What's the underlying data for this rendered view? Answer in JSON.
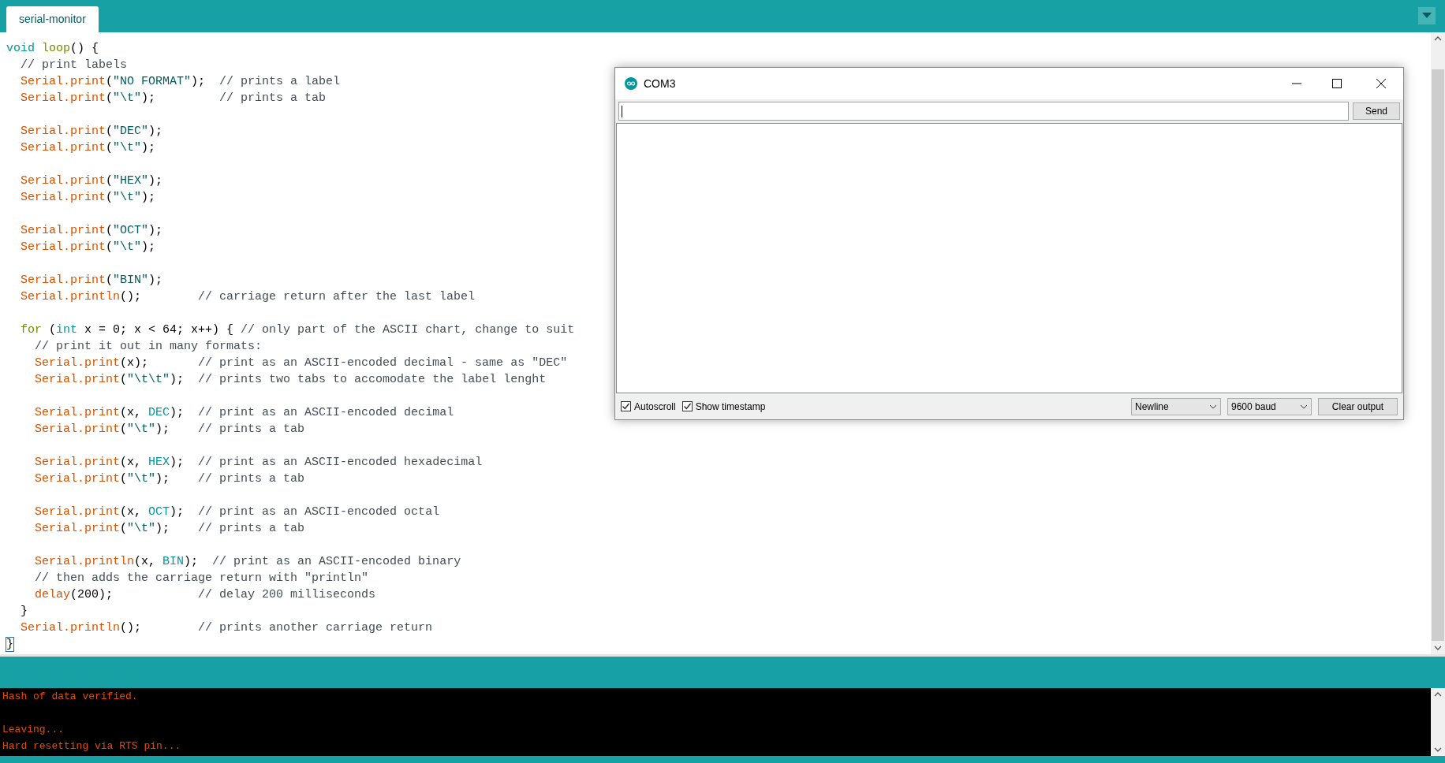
{
  "tabs": [
    {
      "label": "serial-monitor",
      "selected": true
    }
  ],
  "editor": {
    "blocks": [
      [
        [
          {
            "kind": "kw",
            "text": "void "
          },
          {
            "kind": "ctl",
            "text": "loop"
          },
          {
            "kind": "txt",
            "text": "() {"
          }
        ],
        [
          {
            "kind": "com",
            "text": "  // print labels"
          }
        ],
        [
          {
            "kind": "fn",
            "text": "  Serial.print"
          },
          {
            "kind": "txt",
            "text": "("
          },
          {
            "kind": "str",
            "text": "\"NO FORMAT\""
          },
          {
            "kind": "txt",
            "text": ");  "
          },
          {
            "kind": "com",
            "text": "// prints a label"
          }
        ],
        [
          {
            "kind": "fn",
            "text": "  Serial.print"
          },
          {
            "kind": "txt",
            "text": "("
          },
          {
            "kind": "str",
            "text": "\"\\t\""
          },
          {
            "kind": "txt",
            "text": ");         "
          },
          {
            "kind": "com",
            "text": "// prints a tab"
          }
        ]
      ],
      [
        [
          {
            "kind": "fn",
            "text": "  Serial.print"
          },
          {
            "kind": "txt",
            "text": "("
          },
          {
            "kind": "str",
            "text": "\"DEC\""
          },
          {
            "kind": "txt",
            "text": ");"
          }
        ],
        [
          {
            "kind": "fn",
            "text": "  Serial.print"
          },
          {
            "kind": "txt",
            "text": "("
          },
          {
            "kind": "str",
            "text": "\"\\t\""
          },
          {
            "kind": "txt",
            "text": ");"
          }
        ]
      ],
      [
        [
          {
            "kind": "fn",
            "text": "  Serial.print"
          },
          {
            "kind": "txt",
            "text": "("
          },
          {
            "kind": "str",
            "text": "\"HEX\""
          },
          {
            "kind": "txt",
            "text": ");"
          }
        ],
        [
          {
            "kind": "fn",
            "text": "  Serial.print"
          },
          {
            "kind": "txt",
            "text": "("
          },
          {
            "kind": "str",
            "text": "\"\\t\""
          },
          {
            "kind": "txt",
            "text": ");"
          }
        ]
      ],
      [
        [
          {
            "kind": "fn",
            "text": "  Serial.print"
          },
          {
            "kind": "txt",
            "text": "("
          },
          {
            "kind": "str",
            "text": "\"OCT\""
          },
          {
            "kind": "txt",
            "text": ");"
          }
        ],
        [
          {
            "kind": "fn",
            "text": "  Serial.print"
          },
          {
            "kind": "txt",
            "text": "("
          },
          {
            "kind": "str",
            "text": "\"\\t\""
          },
          {
            "kind": "txt",
            "text": ");"
          }
        ]
      ],
      [
        [
          {
            "kind": "fn",
            "text": "  Serial.print"
          },
          {
            "kind": "txt",
            "text": "("
          },
          {
            "kind": "str",
            "text": "\"BIN\""
          },
          {
            "kind": "txt",
            "text": ");"
          }
        ],
        [
          {
            "kind": "fn",
            "text": "  Serial.println"
          },
          {
            "kind": "txt",
            "text": "();        "
          },
          {
            "kind": "com",
            "text": "// carriage return after the last label"
          }
        ]
      ],
      [
        [
          {
            "kind": "ctl",
            "text": "  for"
          },
          {
            "kind": "txt",
            "text": " ("
          },
          {
            "kind": "kw",
            "text": "int"
          },
          {
            "kind": "txt",
            "text": " x = 0; x < 64; x++) { "
          },
          {
            "kind": "com",
            "text": "// only part of the ASCII chart, change to suit"
          }
        ],
        [
          {
            "kind": "com",
            "text": "    // print it out in many formats:"
          }
        ],
        [
          {
            "kind": "fn",
            "text": "    Serial.print"
          },
          {
            "kind": "txt",
            "text": "(x);       "
          },
          {
            "kind": "com",
            "text": "// print as an ASCII-encoded decimal - same as \"DEC\""
          }
        ],
        [
          {
            "kind": "fn",
            "text": "    Serial.print"
          },
          {
            "kind": "txt",
            "text": "("
          },
          {
            "kind": "str",
            "text": "\"\\t\\t\""
          },
          {
            "kind": "txt",
            "text": ");  "
          },
          {
            "kind": "com",
            "text": "// prints two tabs to accomodate the label lenght"
          }
        ]
      ],
      [
        [
          {
            "kind": "fn",
            "text": "    Serial.print"
          },
          {
            "kind": "txt",
            "text": "(x, "
          },
          {
            "kind": "const",
            "text": "DEC"
          },
          {
            "kind": "txt",
            "text": ");  "
          },
          {
            "kind": "com",
            "text": "// print as an ASCII-encoded decimal"
          }
        ],
        [
          {
            "kind": "fn",
            "text": "    Serial.print"
          },
          {
            "kind": "txt",
            "text": "("
          },
          {
            "kind": "str",
            "text": "\"\\t\""
          },
          {
            "kind": "txt",
            "text": ");    "
          },
          {
            "kind": "com",
            "text": "// prints a tab"
          }
        ]
      ],
      [
        [
          {
            "kind": "fn",
            "text": "    Serial.print"
          },
          {
            "kind": "txt",
            "text": "(x, "
          },
          {
            "kind": "const",
            "text": "HEX"
          },
          {
            "kind": "txt",
            "text": ");  "
          },
          {
            "kind": "com",
            "text": "// print as an ASCII-encoded hexadecimal"
          }
        ],
        [
          {
            "kind": "fn",
            "text": "    Serial.print"
          },
          {
            "kind": "txt",
            "text": "("
          },
          {
            "kind": "str",
            "text": "\"\\t\""
          },
          {
            "kind": "txt",
            "text": ");    "
          },
          {
            "kind": "com",
            "text": "// prints a tab"
          }
        ]
      ],
      [
        [
          {
            "kind": "fn",
            "text": "    Serial.print"
          },
          {
            "kind": "txt",
            "text": "(x, "
          },
          {
            "kind": "const",
            "text": "OCT"
          },
          {
            "kind": "txt",
            "text": ");  "
          },
          {
            "kind": "com",
            "text": "// print as an ASCII-encoded octal"
          }
        ],
        [
          {
            "kind": "fn",
            "text": "    Serial.print"
          },
          {
            "kind": "txt",
            "text": "("
          },
          {
            "kind": "str",
            "text": "\"\\t\""
          },
          {
            "kind": "txt",
            "text": ");    "
          },
          {
            "kind": "com",
            "text": "// prints a tab"
          }
        ]
      ],
      [
        [
          {
            "kind": "fn",
            "text": "    Serial.println"
          },
          {
            "kind": "txt",
            "text": "(x, "
          },
          {
            "kind": "const",
            "text": "BIN"
          },
          {
            "kind": "txt",
            "text": ");  "
          },
          {
            "kind": "com",
            "text": "// print as an ASCII-encoded binary"
          }
        ],
        [
          {
            "kind": "com",
            "text": "    // then adds the carriage return with \"println\""
          }
        ],
        [
          {
            "kind": "fn",
            "text": "    delay"
          },
          {
            "kind": "txt",
            "text": "(200);            "
          },
          {
            "kind": "com",
            "text": "// delay 200 milliseconds"
          }
        ],
        [
          {
            "kind": "txt",
            "text": "  }"
          }
        ],
        [
          {
            "kind": "fn",
            "text": "  Serial.println"
          },
          {
            "kind": "txt",
            "text": "();        "
          },
          {
            "kind": "com",
            "text": "// prints another carriage return"
          }
        ],
        [
          {
            "kind": "match",
            "text": "}"
          }
        ]
      ]
    ]
  },
  "serial_monitor": {
    "title": "COM3",
    "send": "Send",
    "autoscroll": {
      "label": "Autoscroll",
      "checked": true
    },
    "timestamp": {
      "label": "Show timestamp",
      "checked": true
    },
    "line_ending": "Newline",
    "baud": "9600 baud",
    "clear": "Clear output"
  },
  "console": {
    "blocks": [
      [
        "Hash of data verified."
      ],
      [
        "Leaving...",
        "Hard resetting via RTS pin..."
      ]
    ]
  }
}
